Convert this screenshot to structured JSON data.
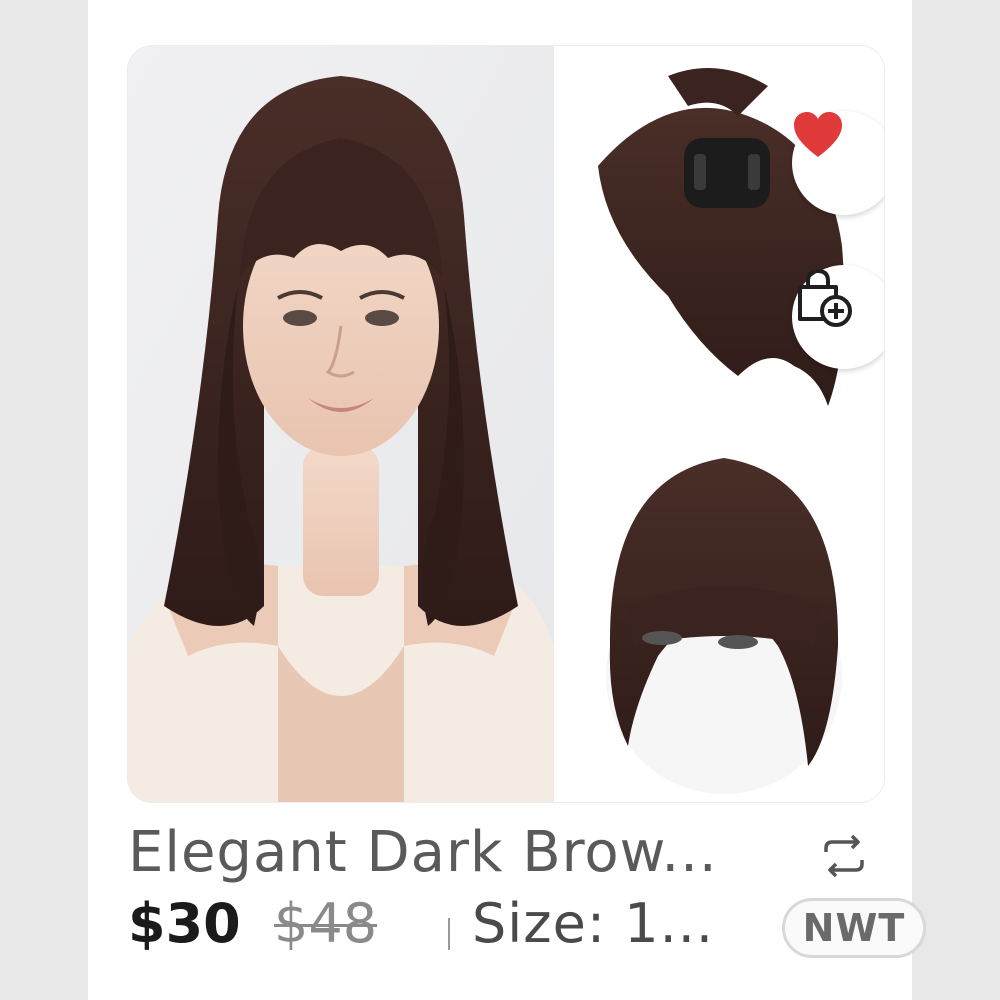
{
  "listing": {
    "title": "Elegant Dark Brow...",
    "price": "$30",
    "original_price": "$48",
    "size": "Size: 1...",
    "condition_badge": "NWT"
  },
  "actions": {
    "like_icon": "heart-icon",
    "bundle_icon": "bag-plus-icon",
    "repost_icon": "repost-icon"
  },
  "colors": {
    "like": "#e03a3a",
    "hair": "#3a2420",
    "text_dark": "#1b1b1b",
    "text_muted": "#8a8a8a"
  }
}
